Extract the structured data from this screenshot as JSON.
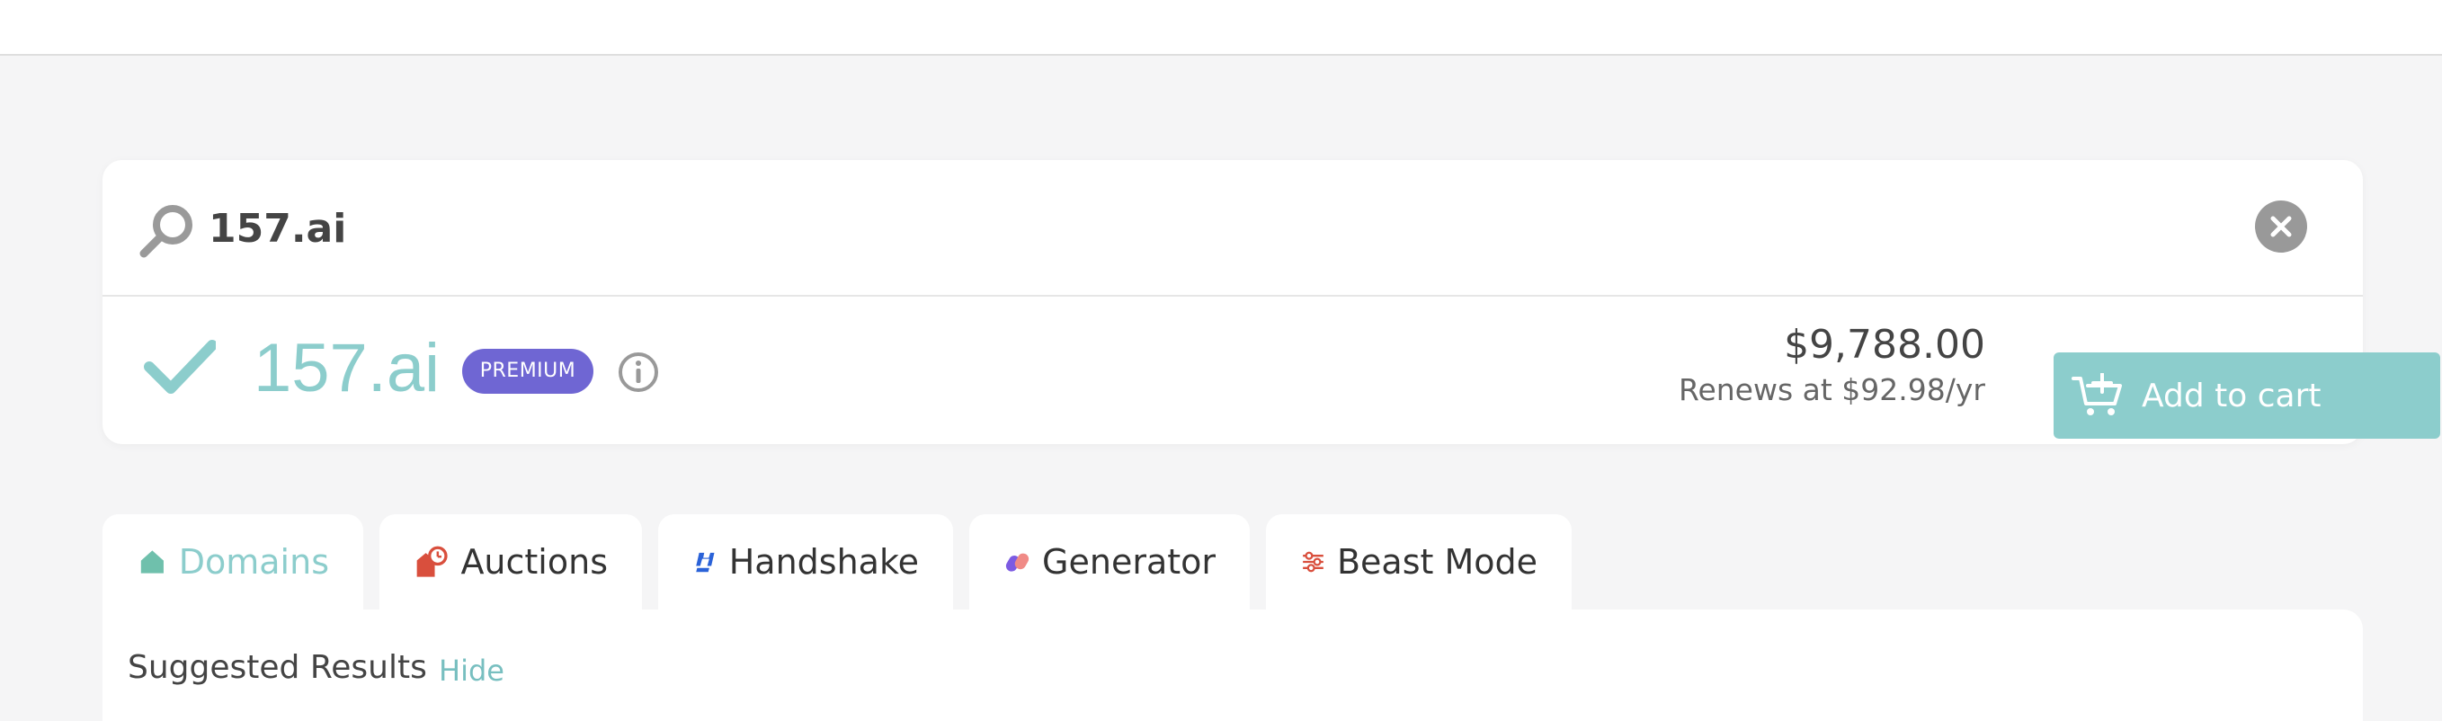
{
  "search": {
    "query": "157.ai",
    "clear_icon": "close-icon"
  },
  "result": {
    "domain": "157.ai",
    "badge": "PREMIUM",
    "price": "$9,788.00",
    "renewal": "Renews at $92.98/yr",
    "add_to_cart_label": "Add to cart",
    "status_icon": "check-icon"
  },
  "tabs": [
    {
      "label": "Domains",
      "icon": "house-icon",
      "active": true
    },
    {
      "label": "Auctions",
      "icon": "auction-icon",
      "active": false
    },
    {
      "label": "Handshake",
      "icon": "handshake-icon",
      "active": false
    },
    {
      "label": "Generator",
      "icon": "generator-icon",
      "active": false
    },
    {
      "label": "Beast Mode",
      "icon": "sliders-icon",
      "active": false
    }
  ],
  "panel": {
    "title": "Suggested Results",
    "hide_label": "Hide"
  },
  "colors": {
    "accent": "#8ccdcc",
    "premium": "#6f66d3",
    "background": "#f5f5f6"
  }
}
